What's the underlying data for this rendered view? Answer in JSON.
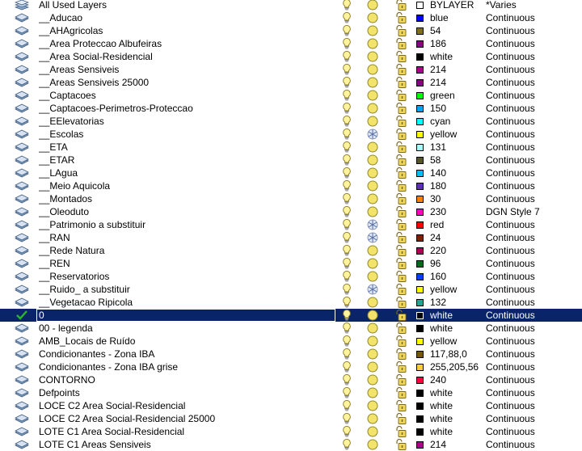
{
  "layers": [
    {
      "name": "All Used Layers",
      "status": "stack",
      "on": true,
      "freeze": "sun",
      "lock": true,
      "color": "#ffffff",
      "color_name": "BYLAYER",
      "linetype": "*Varies"
    },
    {
      "name": "__Aducao",
      "status": "layer",
      "on": true,
      "freeze": "sun",
      "lock": true,
      "color": "#0000ff",
      "color_name": "blue",
      "linetype": "Continuous"
    },
    {
      "name": "__AHAgricolas",
      "status": "layer",
      "on": true,
      "freeze": "sun",
      "lock": true,
      "color": "#7f6f1e",
      "color_name": "54",
      "linetype": "Continuous"
    },
    {
      "name": "__Area Proteccao Albufeiras",
      "status": "layer",
      "on": true,
      "freeze": "sun",
      "lock": true,
      "color": "#8a007f",
      "color_name": "186",
      "linetype": "Continuous"
    },
    {
      "name": "__Area Social-Residencial",
      "status": "layer",
      "on": true,
      "freeze": "sun",
      "lock": true,
      "color": "#000000",
      "color_name": "white",
      "linetype": "Continuous"
    },
    {
      "name": "__Areas Sensiveis",
      "status": "layer",
      "on": true,
      "freeze": "sun",
      "lock": true,
      "color": "#b0008a",
      "color_name": "214",
      "linetype": "Continuous"
    },
    {
      "name": "__Areas Sensiveis 25000",
      "status": "layer",
      "on": true,
      "freeze": "sun",
      "lock": true,
      "color": "#8a0080",
      "color_name": "214",
      "linetype": "Continuous"
    },
    {
      "name": "__Captacoes",
      "status": "layer",
      "on": true,
      "freeze": "sun",
      "lock": true,
      "color": "#00ff00",
      "color_name": "green",
      "linetype": "Continuous"
    },
    {
      "name": "__Captacoes-Perimetros-Proteccao",
      "status": "layer",
      "on": true,
      "freeze": "sun",
      "lock": true,
      "color": "#00a5ff",
      "color_name": "150",
      "linetype": "Continuous"
    },
    {
      "name": "__EElevatorias",
      "status": "layer",
      "on": true,
      "freeze": "sun",
      "lock": true,
      "color": "#00ffff",
      "color_name": "cyan",
      "linetype": "Continuous"
    },
    {
      "name": "__Escolas",
      "status": "layer",
      "on": true,
      "freeze": "snow",
      "lock": true,
      "color": "#ffff00",
      "color_name": "yellow",
      "linetype": "Continuous"
    },
    {
      "name": "__ETA",
      "status": "layer",
      "on": true,
      "freeze": "sun",
      "lock": true,
      "color": "#a8ffff",
      "color_name": "131",
      "linetype": "Continuous"
    },
    {
      "name": "__ETAR",
      "status": "layer",
      "on": true,
      "freeze": "sun",
      "lock": true,
      "color": "#56562a",
      "color_name": "58",
      "linetype": "Continuous"
    },
    {
      "name": "__LAgua",
      "status": "layer",
      "on": true,
      "freeze": "sun",
      "lock": true,
      "color": "#00bfff",
      "color_name": "140",
      "linetype": "Continuous"
    },
    {
      "name": "__Meio Aquicola",
      "status": "layer",
      "on": true,
      "freeze": "sun",
      "lock": true,
      "color": "#5e2fb8",
      "color_name": "180",
      "linetype": "Continuous"
    },
    {
      "name": "__Montados",
      "status": "layer",
      "on": true,
      "freeze": "sun",
      "lock": true,
      "color": "#ff7f00",
      "color_name": "30",
      "linetype": "Continuous"
    },
    {
      "name": "__Oleoduto",
      "status": "layer",
      "on": true,
      "freeze": "sun",
      "lock": true,
      "color": "#ff00bf",
      "color_name": "230",
      "linetype": "DGN Style 7"
    },
    {
      "name": "__Patrimonio a substituir",
      "status": "layer",
      "on": true,
      "freeze": "snow",
      "lock": true,
      "color": "#ff0000",
      "color_name": "red",
      "linetype": "Continuous"
    },
    {
      "name": "__RAN",
      "status": "layer",
      "on": true,
      "freeze": "snow",
      "lock": true,
      "color": "#7f1f00",
      "color_name": "24",
      "linetype": "Continuous"
    },
    {
      "name": "__Rede Natura",
      "status": "layer",
      "on": true,
      "freeze": "sun",
      "lock": true,
      "color": "#b00056",
      "color_name": "220",
      "linetype": "Continuous"
    },
    {
      "name": "__REN",
      "status": "layer",
      "on": true,
      "freeze": "sun",
      "lock": true,
      "color": "#006b1f",
      "color_name": "96",
      "linetype": "Continuous"
    },
    {
      "name": "__Reservatorios",
      "status": "layer",
      "on": true,
      "freeze": "sun",
      "lock": true,
      "color": "#003fff",
      "color_name": "160",
      "linetype": "Continuous"
    },
    {
      "name": "__Ruido_ a substituir",
      "status": "layer",
      "on": true,
      "freeze": "snow",
      "lock": true,
      "color": "#ffff00",
      "color_name": "yellow",
      "linetype": "Continuous"
    },
    {
      "name": "__Vegetacao Ripicola",
      "status": "layer",
      "on": true,
      "freeze": "sun",
      "lock": true,
      "color": "#21a590",
      "color_name": "132",
      "linetype": "Continuous"
    },
    {
      "name": "0",
      "status": "current",
      "on": true,
      "freeze": "sun",
      "lock": true,
      "color": "#000000",
      "color_name": "white",
      "linetype": "Continuous",
      "selected": true
    },
    {
      "name": "00 - legenda",
      "status": "layer",
      "on": true,
      "freeze": "sun",
      "lock": true,
      "color": "#000000",
      "color_name": "white",
      "linetype": "Continuous"
    },
    {
      "name": "AMB_Locais de Ruído",
      "status": "layer",
      "on": true,
      "freeze": "sun",
      "lock": true,
      "color": "#ffff00",
      "color_name": "yellow",
      "linetype": "Continuous"
    },
    {
      "name": "Condicionantes - Zona IBA",
      "status": "layer",
      "on": true,
      "freeze": "sun",
      "lock": true,
      "color": "#755800",
      "color_name": "117,88,0",
      "linetype": "Continuous"
    },
    {
      "name": "Condicionantes - Zona IBA grise",
      "status": "layer",
      "on": true,
      "freeze": "sun",
      "lock": true,
      "color": "#ffcd38",
      "color_name": "255,205,56",
      "linetype": "Continuous"
    },
    {
      "name": "CONTORNO",
      "status": "layer",
      "on": true,
      "freeze": "sun",
      "lock": true,
      "color": "#ff0040",
      "color_name": "240",
      "linetype": "Continuous"
    },
    {
      "name": "Defpoints",
      "status": "layer",
      "on": true,
      "freeze": "sun",
      "lock": true,
      "color": "#000000",
      "color_name": "white",
      "linetype": "Continuous"
    },
    {
      "name": "LOCE C2 Area Social-Residencial",
      "status": "layer",
      "on": true,
      "freeze": "sun",
      "lock": true,
      "color": "#000000",
      "color_name": "white",
      "linetype": "Continuous"
    },
    {
      "name": "LOCE C2 Area Social-Residencial 25000",
      "status": "layer",
      "on": true,
      "freeze": "sun",
      "lock": true,
      "color": "#000000",
      "color_name": "white",
      "linetype": "Continuous"
    },
    {
      "name": "LOTE C1 Area Social-Residencial",
      "status": "layer",
      "on": true,
      "freeze": "sun",
      "lock": true,
      "color": "#000000",
      "color_name": "white",
      "linetype": "Continuous"
    },
    {
      "name": "LOTE C1 Areas Sensiveis",
      "status": "layer",
      "on": true,
      "freeze": "sun",
      "lock": true,
      "color": "#b0008a",
      "color_name": "214",
      "linetype": "Continuous"
    }
  ]
}
